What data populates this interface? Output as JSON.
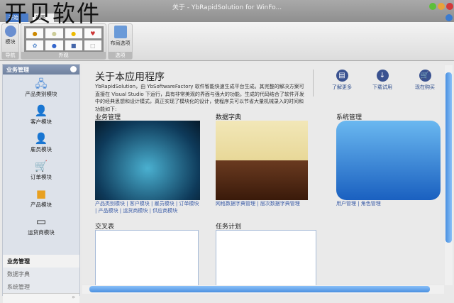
{
  "window": {
    "title": "关于 - YbRapidSolution for WinFo...",
    "watermark": "开贝软件",
    "tabs": [
      "开始",
      "视图"
    ]
  },
  "ribbon": {
    "groups": [
      {
        "label": "导航",
        "button": "模块"
      },
      {
        "label": "外观"
      },
      {
        "label": "选项",
        "button": "布局选项"
      }
    ]
  },
  "sidebar": {
    "header": "业务管理",
    "items": [
      "产品类别模块",
      "客户模块",
      "雇员模块",
      "订单模块",
      "产品模块",
      "运货商模块"
    ],
    "nav": [
      "业务管理",
      "数据字典",
      "系统管理"
    ]
  },
  "main": {
    "title": "关于本应用程序",
    "description": "YbRapidSolution，由 YbSoftwareFactory 软件智能快速生成平台生成。其完整的解决方案可直接在 Visual Studio 下运行，具有非常美观的界面与强大的功能。生成的代码结合了软件开发中的经典思想和设计模式，真正实现了模块化的设计，使程序员可以节省大量机械录入的时间和",
    "description2": "功能如下:",
    "actions": [
      "了解更多",
      "下载试用",
      "现在购买"
    ],
    "sections": [
      {
        "title": "业务管理",
        "links": "产品类别模块 | 客户模块 | 雇员模块 | 订单模块 | 产品模块 | 运货商模块 | 供应商模块"
      },
      {
        "title": "数据字典",
        "links": "网格数据字典管理 | 层次数据字典管理"
      },
      {
        "title": "系统管理",
        "links": "用户管理 | 角色管理"
      },
      {
        "title": "交叉表"
      },
      {
        "title": "任务计划"
      }
    ]
  }
}
